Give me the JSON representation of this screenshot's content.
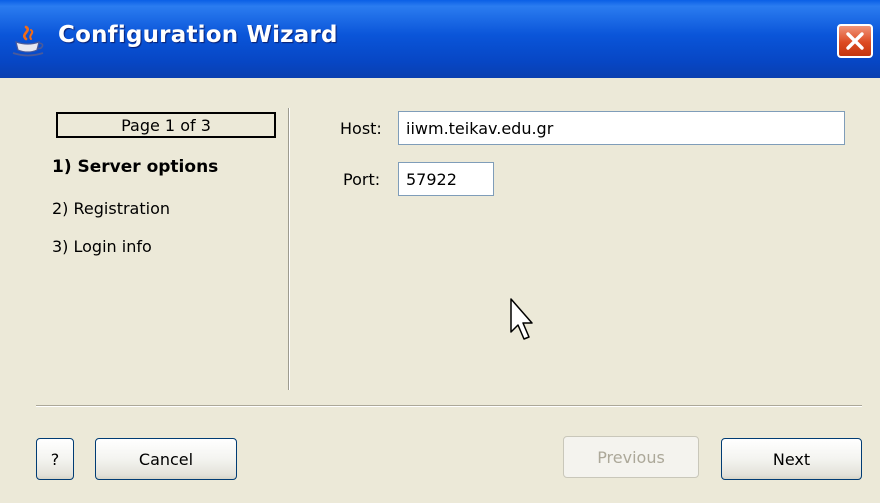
{
  "window": {
    "title": "Configuration Wizard",
    "icon": "java-icon",
    "close_icon": "close-icon"
  },
  "wizard": {
    "page_indicator": "Page 1 of 3",
    "steps": [
      {
        "label": "1) Server options",
        "active": true
      },
      {
        "label": "2) Registration",
        "active": false
      },
      {
        "label": "3) Login info",
        "active": false
      }
    ]
  },
  "form": {
    "host_label": "Host:",
    "host_value": "iiwm.teikav.edu.gr",
    "port_label": "Port:",
    "port_value": "57922"
  },
  "buttons": {
    "help": "?",
    "cancel": "Cancel",
    "previous": "Previous",
    "next": "Next"
  },
  "colors": {
    "titlebar": "#0a55d9",
    "window_bg": "#ece9d8",
    "close_button": "#dd4b22",
    "input_border": "#7f9db9",
    "button_border": "#003c74"
  }
}
